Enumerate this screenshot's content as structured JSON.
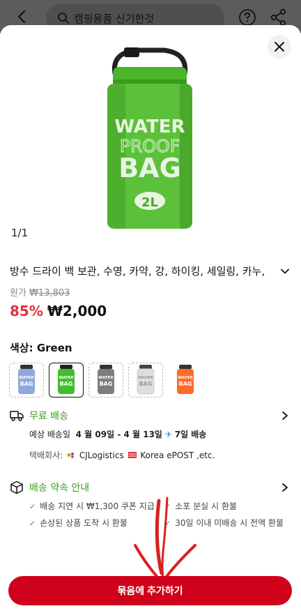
{
  "header": {
    "search_text": "캠핑용품 신기한것",
    "icons": [
      "back-arrow-icon",
      "search-icon",
      "help-icon",
      "share-icon"
    ]
  },
  "product": {
    "image_text": {
      "line1": "WATER",
      "line2": "PROOF",
      "line3": "BAG",
      "size": "2L"
    },
    "image_counter": "1/1",
    "title": "방수 드라이 백 보관, 수영, 카약, 강, 하이킹, 세일링, 카누,",
    "original_price_label": "원가",
    "original_price": "₩13,803",
    "discount": "85%",
    "price": "₩2,000"
  },
  "options": {
    "color_label": "색상: Green",
    "swatches": [
      {
        "name": "Blue",
        "color": "#8fa8dc",
        "selected": false
      },
      {
        "name": "Green",
        "color": "#3fbf2a",
        "selected": true
      },
      {
        "name": "Gray",
        "color": "#7d7d7d",
        "selected": false
      },
      {
        "name": "White",
        "color": "#dedede",
        "selected": false
      },
      {
        "name": "Orange",
        "color": "#ff6a2a",
        "selected": false
      }
    ]
  },
  "shipping": {
    "free_label": "무료 배송",
    "eta_label": "예상 배송일",
    "eta_range": "4 월 09일 - 4 월 13일",
    "eta_days": "7일 배송",
    "courier_label": "택배회사:",
    "courier_1": "CJLogistics",
    "courier_2": "Korea ePOST ,etc."
  },
  "promise": {
    "title": "배송 약속 안내",
    "items": [
      "배송 지연 시 ₩1,300 쿠폰 지급",
      "소포 분실 시 환불",
      "손상된 상품 도착 시 환불",
      "30일 이내 미배송 시 전액 환불"
    ]
  },
  "cta": {
    "label": "묶음에 추가하기"
  },
  "colors": {
    "accent_red": "#d0021b",
    "price_red": "#e2303e",
    "green": "#3a9f1a"
  }
}
